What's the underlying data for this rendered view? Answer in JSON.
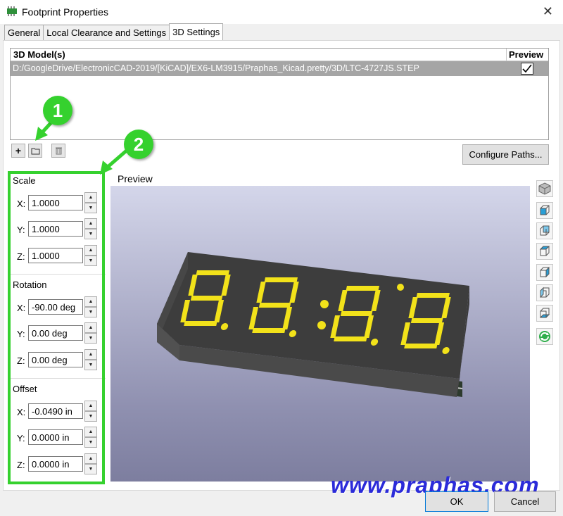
{
  "window": {
    "title": "Footprint Properties"
  },
  "tabs": [
    {
      "label": "General"
    },
    {
      "label": "Local Clearance and Settings"
    },
    {
      "label": "3D Settings"
    }
  ],
  "models": {
    "col_model": "3D Model(s)",
    "col_preview": "Preview",
    "rows": [
      {
        "path": "D:/GoogleDrive/ElectronicCAD-2019/[KiCAD]/EX6-LM3915/Praphas_Kicad.pretty/3D/LTC-4727JS.STEP",
        "preview": true
      }
    ]
  },
  "buttons": {
    "add": "+",
    "configure_paths": "Configure Paths...",
    "ok": "OK",
    "cancel": "Cancel"
  },
  "scale": {
    "label": "Scale",
    "x": "1.0000",
    "y": "1.0000",
    "z": "1.0000"
  },
  "rotation": {
    "label": "Rotation",
    "x": "-90.00 deg",
    "y": "0.00 deg",
    "z": "0.00 deg"
  },
  "offset": {
    "label": "Offset",
    "x": "-0.0490 in",
    "y": "0.0000 in",
    "z": "0.0000 in"
  },
  "axes": {
    "x": "X:",
    "y": "Y:",
    "z": "Z:"
  },
  "preview": {
    "label": "Preview"
  },
  "callouts": {
    "one": "1",
    "two": "2"
  },
  "watermark": "www.praphas.com",
  "colors": {
    "callout_green": "#35d12e",
    "segment_yellow": "#f2e21a",
    "watermark_blue": "#2b2bd9"
  }
}
